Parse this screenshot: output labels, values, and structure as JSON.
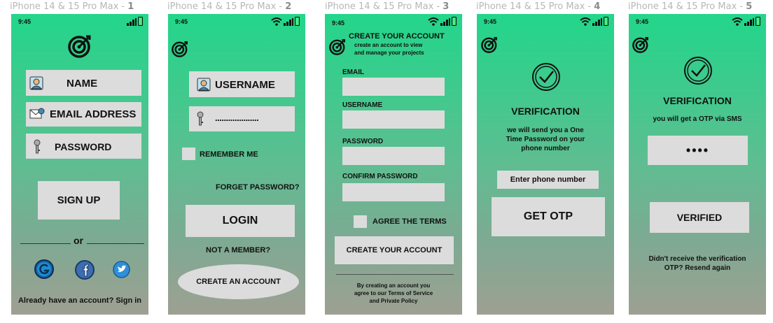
{
  "frames": [
    "iPhone 14 & 15 Pro Max - ",
    "iPhone 14 & 15 Pro Max - ",
    "iPhone 14 & 15 Pro Max - ",
    "iPhone 14 & 15 Pro Max - ",
    "iPhone 14 & 15 Pro Max - "
  ],
  "frame_numbers": [
    "1",
    "2",
    "3",
    "4",
    "5"
  ],
  "status_time": "9:45",
  "colors": {
    "gradient_top": "#22d68a",
    "gradient_bottom": "#9ea092",
    "field_bg": "#dcdcdc",
    "text": "#111111"
  },
  "screen1": {
    "name_label": "NAME",
    "email_label": "EMAIL ADDRESS",
    "password_label": "PASSWORD",
    "signup_button": "SIGN UP",
    "or_text": "or",
    "signin_text": "Already have an account? Sign in",
    "social": [
      "google-icon",
      "facebook-icon",
      "twitter-icon"
    ]
  },
  "screen2": {
    "username_label": "USERNAME",
    "password_mask": "....................",
    "remember_me": "REMEMBER ME",
    "forget_password": "FORGET PASSWORD?",
    "login_button": "LOGIN",
    "not_member": "NOT A MEMBER?",
    "create_account_button": "CREATE AN ACCOUNT"
  },
  "screen3": {
    "title": "CREATE YOUR ACCOUNT",
    "subtitle_1": "create an account to view",
    "subtitle_2": "and manage your projects",
    "email_label": "EMAIL",
    "username_label": "USERNAME",
    "password_label": "PASSWORD",
    "confirm_password_label": "CONFIRM PASSWORD",
    "agree_terms": "AGREE THE TERMS",
    "create_button": "CREATE YOUR ACCOUNT",
    "terms_1": "By creating an account you",
    "terms_2": "agree to our Terms of Service",
    "terms_3": "and Private Policy"
  },
  "screen4": {
    "title": "VERIFICATION",
    "desc_1": "we will send you a One",
    "desc_2": "Time  Password on your",
    "desc_3": "phone number",
    "phone_placeholder": "Enter phone number",
    "get_otp_button": "GET OTP"
  },
  "screen5": {
    "title": "VERIFICATION",
    "subtitle": "you will get a OTP via SMS",
    "otp_mask": "••••",
    "verified_button": "VERIFIED",
    "resend_1": "Didn't receive the verification",
    "resend_2": "OTP? Resend again"
  }
}
